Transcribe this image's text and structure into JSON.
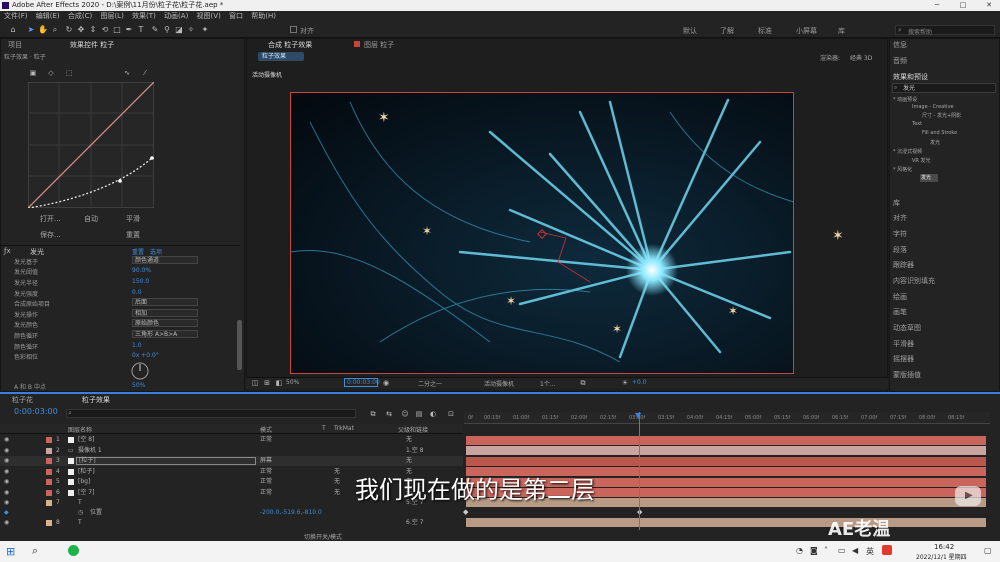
{
  "window": {
    "title": "Adobe After Effects 2020 - D:\\案例\\11月份\\粒子花\\粒子花.aep *",
    "min": "─",
    "max": "□",
    "close": "✕"
  },
  "menu": [
    "文件(F)",
    "编辑(E)",
    "合成(C)",
    "图层(L)",
    "效果(T)",
    "动画(A)",
    "视图(V)",
    "窗口",
    "帮助(H)"
  ],
  "toolbar": {
    "snap_label": "对齐",
    "workspaces": [
      "默认",
      "了解",
      "标准",
      "小屏幕",
      "库"
    ],
    "search_placeholder": "搜索帮助"
  },
  "left_panel": {
    "tab_project": "项目",
    "tab_effects": "效果控件 粒子",
    "breadcrumb": "粒子效果 · 粒子",
    "curve_buttons": [
      "打开...",
      "自动",
      "平滑",
      "保存...",
      "重置"
    ],
    "effect_name": "发光",
    "effect_reset": "重置",
    "effect_options": "选项",
    "properties": [
      {
        "label": "发光基于",
        "value": "颜色通道",
        "type": "dropdown"
      },
      {
        "label": "发光阈值",
        "value": "90.0%",
        "type": "number"
      },
      {
        "label": "发光半径",
        "value": "150.0",
        "type": "number"
      },
      {
        "label": "发光强度",
        "value": "0.0",
        "type": "number"
      },
      {
        "label": "合成原始项目",
        "value": "后面",
        "type": "dropdown"
      },
      {
        "label": "发光操作",
        "value": "相加",
        "type": "dropdown"
      },
      {
        "label": "发光颜色",
        "value": "原始颜色",
        "type": "dropdown"
      },
      {
        "label": "颜色循环",
        "value": "三角形 A>B>A",
        "type": "dropdown"
      },
      {
        "label": "颜色循环",
        "value": "1.0",
        "type": "number"
      },
      {
        "label": "色彩相位",
        "value": "0x +0.0°",
        "type": "number"
      }
    ],
    "last_prop": "A 和 B 中点",
    "last_value": "50%"
  },
  "comp_panel": {
    "tab_comp": "合成 粒子效果",
    "tab_layer": "图层 粒子",
    "subtab": "粒子效果",
    "renderer_label": "渲染器:",
    "renderer_value": "经典 3D",
    "camera_label": "活动摄像机",
    "zoom": "50%",
    "timecode": "0:00:03:00",
    "resolution": "二分之一",
    "camera_dd": "活动摄像机",
    "views": "1个...",
    "exposure": "+0.0"
  },
  "right_panel": {
    "items_top": [
      "信息",
      "音频"
    ],
    "effects_title": "效果和预设",
    "search_value": "发光",
    "tree": [
      "* 动画预设",
      "Image - Creative",
      "尺寸 - 发光+阴影",
      "Text",
      "Fill and Stroke",
      "发光",
      "* 沉浸式视频",
      "VR 发光",
      "* 风格化",
      "发光"
    ],
    "items_bottom": [
      "库",
      "对齐",
      "字符",
      "段落",
      "跟踪器",
      "内容识别填充",
      "绘画",
      "画笔",
      "动态草图",
      "平滑器",
      "摇摆器",
      "蒙版插值"
    ]
  },
  "timeline": {
    "tab1": "粒子花",
    "tab2": "粒子效果",
    "timecode": "0:00:03:00",
    "col_name": "图层名称",
    "col_mode": "模式",
    "col_t": "T",
    "col_trkmat": "TrkMat",
    "col_parent": "父级和链接",
    "ruler": [
      "0f",
      "00:15f",
      "01:00f",
      "01:15f",
      "02:00f",
      "02:15f",
      "03:00f",
      "03:15f",
      "04:00f",
      "04:15f",
      "05:00f",
      "05:15f",
      "06:00f",
      "06:15f",
      "07:00f",
      "07:15f",
      "08:00f",
      "08:15f"
    ],
    "layers": [
      {
        "num": "1",
        "name": "[空 8]",
        "mode": "正常",
        "trk": "",
        "parent": "无"
      },
      {
        "num": "2",
        "name": "摄像机 1",
        "mode": "",
        "trk": "",
        "parent": "1.空 8"
      },
      {
        "num": "3",
        "name": "[粒子]",
        "mode": "屏幕",
        "trk": "",
        "parent": "无"
      },
      {
        "num": "4",
        "name": "[粒子]",
        "mode": "正常",
        "trk": "无",
        "parent": "无"
      },
      {
        "num": "5",
        "name": "[bg]",
        "mode": "正常",
        "trk": "无",
        "parent": "无"
      },
      {
        "num": "6",
        "name": "[空 7]",
        "mode": "正常",
        "trk": "无",
        "parent": "无"
      },
      {
        "num": "7",
        "name": "T",
        "mode": "",
        "trk": "",
        "parent": "5.空 7"
      },
      {
        "num": "",
        "name": "位置",
        "mode": "-200.0,-519.6,-810.0",
        "trk": "",
        "parent": ""
      },
      {
        "num": "8",
        "name": "T",
        "mode": "",
        "trk": "",
        "parent": "6.空 7"
      }
    ],
    "footer": "切换开关/模式"
  },
  "subtitle": "我们现在做的是第二层",
  "watermark": "AE老温",
  "taskbar": {
    "lang": "英",
    "time": "16:42",
    "date": "2022/12/1 星期四"
  },
  "colors": {
    "accent": "#3f8ddd",
    "layer_red": "#c9655b",
    "layer_tan": "#b89a85",
    "playhead": "#3d7fe0"
  }
}
